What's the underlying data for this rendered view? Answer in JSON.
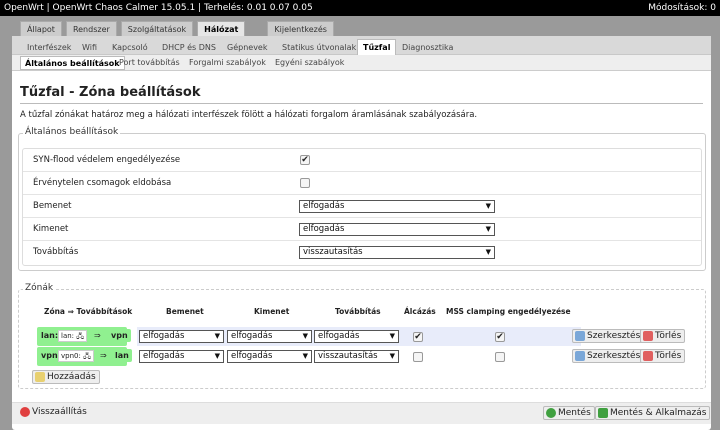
{
  "header": {
    "left": "OpenWrt | OpenWrt Chaos Calmer 15.05.1 | Terhelés: 0.01 0.07 0.05",
    "right": "Módosítások: 0"
  },
  "main_tabs": [
    "Állapot",
    "Rendszer",
    "Szolgáltatások",
    "Hálózat",
    "Kijelentkezés"
  ],
  "sub_tabs": [
    "Interfészek",
    "Wifi",
    "Kapcsoló",
    "DHCP és DNS",
    "Gépnevek",
    "Statikus útvonalak",
    "Tűzfal",
    "Diagnosztika"
  ],
  "tert_tabs": [
    "Általános beállítások",
    "Port továbbítás",
    "Forgalmi szabályok",
    "Egyéni szabályok"
  ],
  "title": "Tűzfal - Zóna beállítások",
  "description": "A tűzfal zónákat határoz meg a hálózati interfészek fölött a hálózati forgalom áramlásának szabályozására.",
  "general": {
    "legend": "Általános beállítások",
    "syn_label": "SYN-flood védelem engedélyezése",
    "invalid_label": "Érvénytelen csomagok eldobása",
    "input_label": "Bemenet",
    "input_value": "elfogadás",
    "output_label": "Kimenet",
    "output_value": "elfogadás",
    "forward_label": "Továbbítás",
    "forward_value": "visszautasítás"
  },
  "zones": {
    "legend": "Zónák",
    "headers": {
      "zone": "Zóna ⇒ Továbbítások",
      "input": "Bemenet",
      "output": "Kimenet",
      "forward": "Továbbítás",
      "masq": "Álcázás",
      "mss": "MSS clamping engedélyezése"
    },
    "rows": [
      {
        "name": "lan:",
        "iface": "lan:",
        "arrow": "⇒",
        "dest": "vpn",
        "input": "elfogadás",
        "output": "elfogadás",
        "forward": "elfogadás",
        "masq": true,
        "mss": true
      },
      {
        "name": "vpn:",
        "iface": "vpn0:",
        "arrow": "⇒",
        "dest": "lan",
        "input": "elfogadás",
        "output": "elfogadás",
        "forward": "visszautasítás",
        "masq": false,
        "mss": false
      }
    ],
    "edit_label": "Szerkesztés",
    "delete_label": "Törlés",
    "add_label": "Hozzáadás"
  },
  "footer": {
    "reset_label": "Visszaállítás",
    "save_label": "Mentés",
    "save_apply_label": "Mentés & Alkalmazás"
  },
  "colors": {
    "zone_green": "#90f090",
    "highlight_row": "#e8ecfa"
  }
}
